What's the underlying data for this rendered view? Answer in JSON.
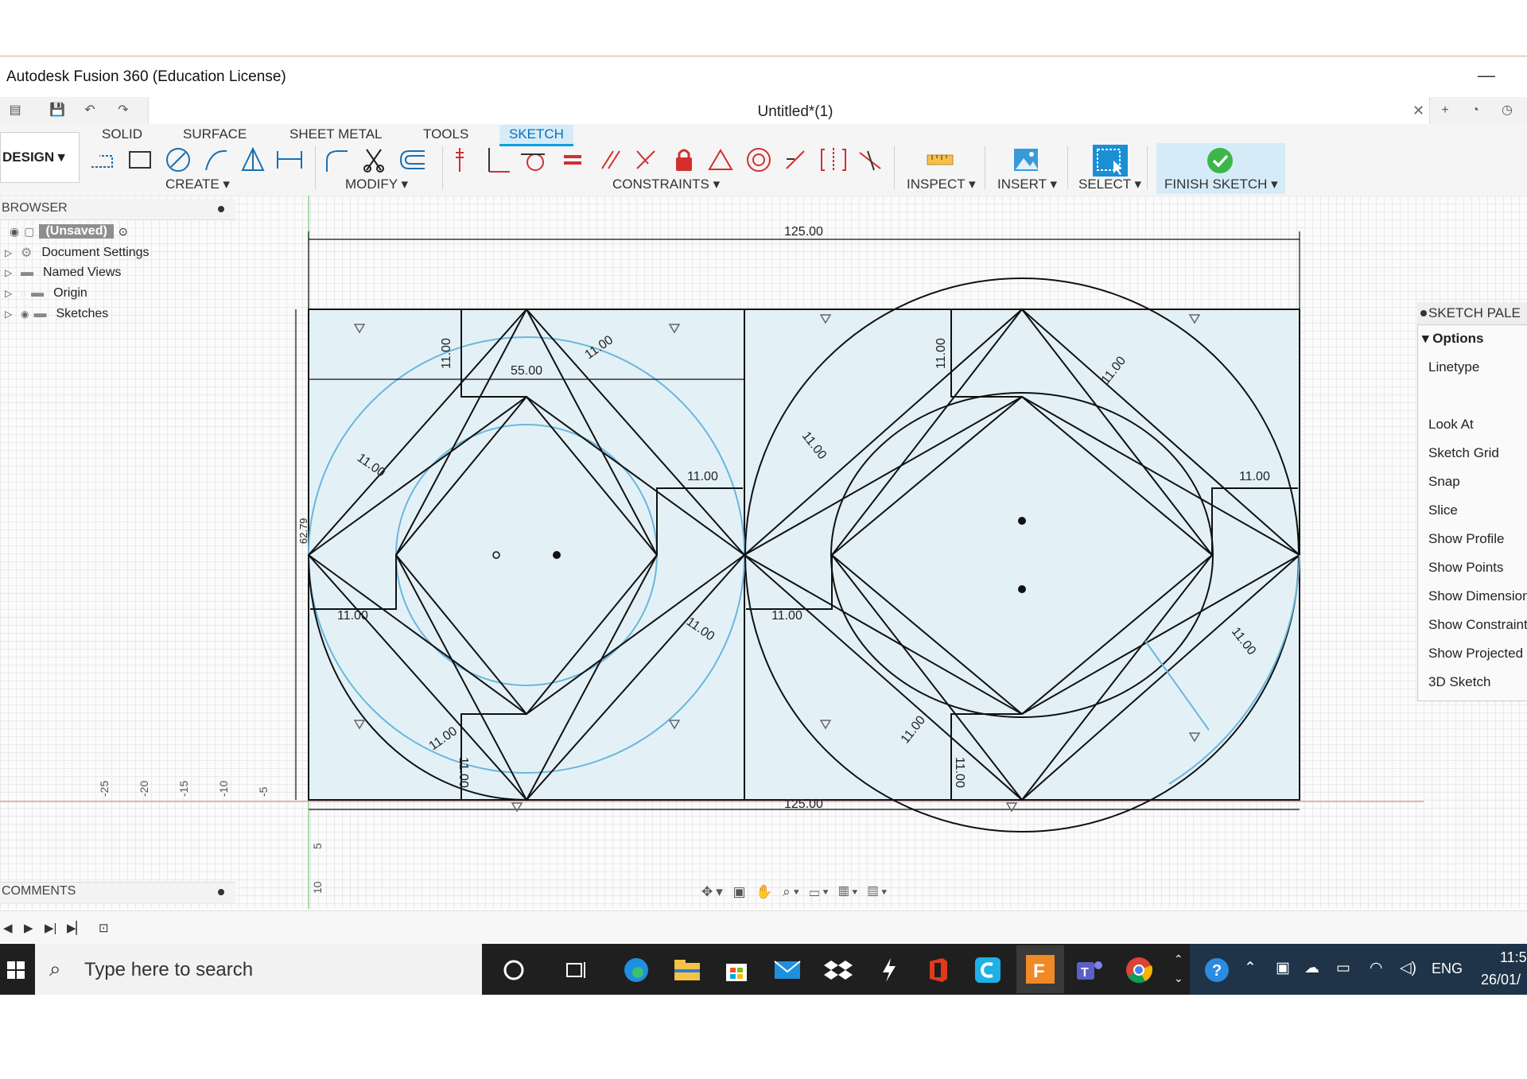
{
  "app": {
    "title": "Autodesk Fusion 360 (Education License)",
    "document_title": "Untitled*(1)"
  },
  "ribbon": {
    "tabs": [
      "SOLID",
      "SURFACE",
      "SHEET METAL",
      "TOOLS",
      "SKETCH"
    ],
    "active_tab": "SKETCH",
    "workspace": "DESIGN",
    "groups": {
      "create": "CREATE",
      "modify": "MODIFY",
      "constraints": "CONSTRAINTS",
      "inspect": "INSPECT",
      "insert": "INSERT",
      "select": "SELECT",
      "finish": "FINISH SKETCH"
    }
  },
  "browser": {
    "title": "BROWSER",
    "root": "(Unsaved)",
    "items": [
      "Document Settings",
      "Named Views",
      "Origin",
      "Sketches"
    ]
  },
  "comments": {
    "title": "COMMENTS"
  },
  "palette": {
    "title": "SKETCH PALE",
    "section": "Options",
    "options": [
      "Linetype",
      "Look At",
      "Sketch Grid",
      "Snap",
      "Slice",
      "Show Profile",
      "Show Points",
      "Show Dimension",
      "Show Constraint",
      "Show Projected",
      "3D Sketch"
    ]
  },
  "sketch": {
    "dimensions": [
      "125.00",
      "55.00",
      "11.00",
      "62.79"
    ],
    "ruler_x": [
      "-25",
      "-20",
      "-15",
      "-10",
      "-5"
    ],
    "ruler_y": [
      "5",
      "10"
    ]
  },
  "taskbar": {
    "search_placeholder": "Type here to search",
    "language": "ENG",
    "time": "11:5",
    "date": "26/01/"
  },
  "colors": {
    "accent": "#0a9fe3",
    "sketch_line": "#111111",
    "construction": "#6ab7dd",
    "profile_fill": "#e3f1f7",
    "taskbar": "#1f1f1f"
  }
}
